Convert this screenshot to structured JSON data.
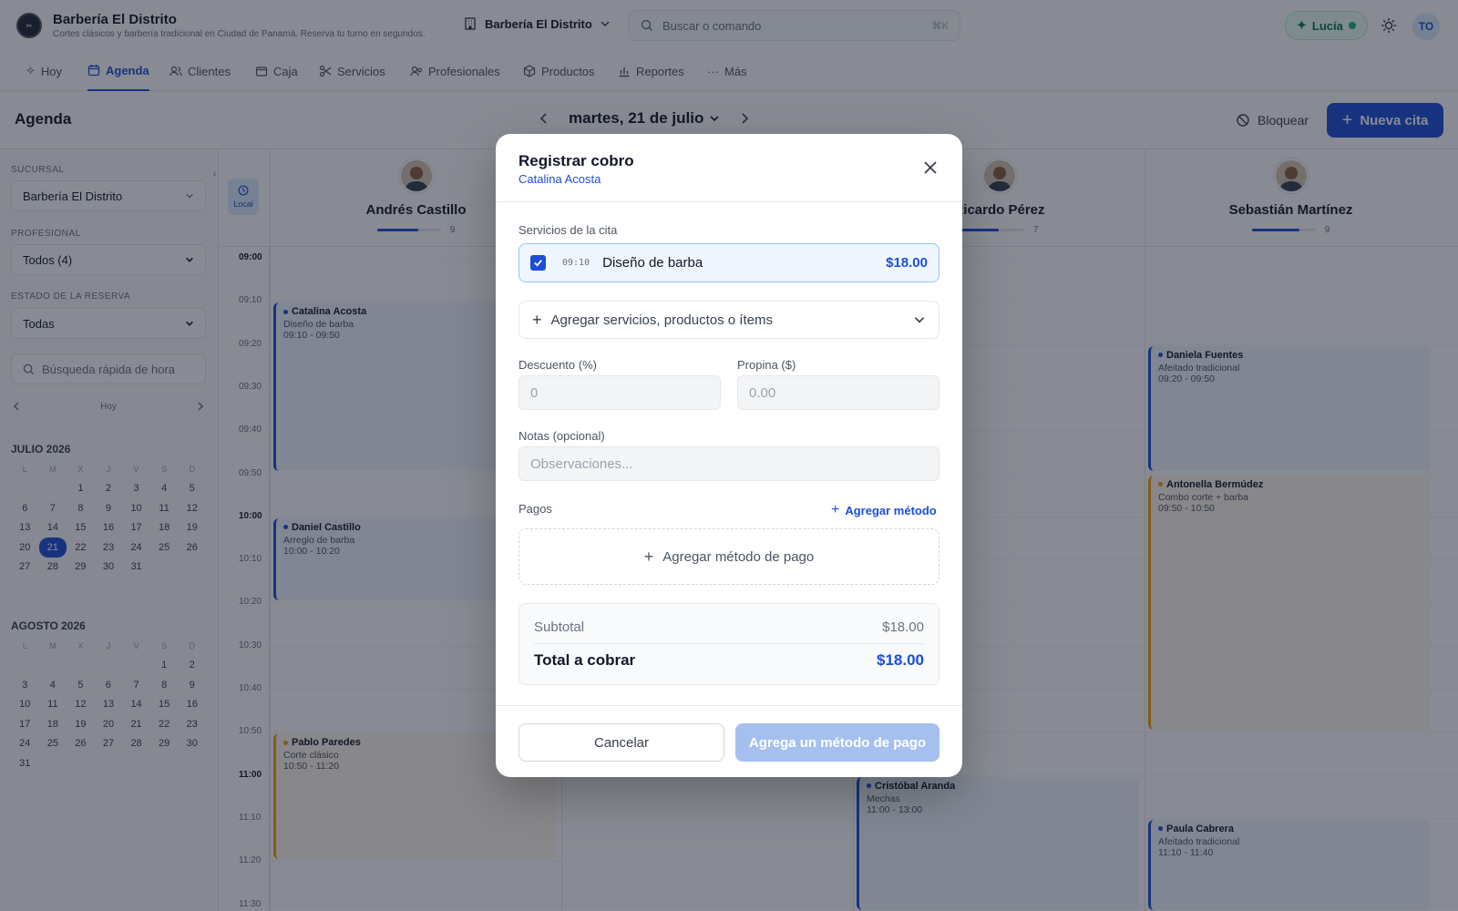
{
  "app": {
    "title": "Barbería El Distrito",
    "subtitle": "Cortes clásicos y barbería tradicional en Ciudad de Panamá. Reserva tu turno en segundos.",
    "branch_selector": "Barbería El Distrito",
    "search_placeholder": "Buscar o comando",
    "search_shortcut": "⌘K",
    "assistant_label": "Lucía",
    "user_initials": "TO"
  },
  "nav": {
    "items": [
      {
        "label": "Hoy",
        "icon": "sparkle-icon"
      },
      {
        "label": "Agenda",
        "icon": "calendar-icon",
        "active": true
      },
      {
        "label": "Clientes",
        "icon": "users-icon"
      },
      {
        "label": "Caja",
        "icon": "wallet-icon"
      },
      {
        "label": "Servicios",
        "icon": "scissors-icon"
      },
      {
        "label": "Profesionales",
        "icon": "user-group-icon"
      },
      {
        "label": "Productos",
        "icon": "box-icon"
      },
      {
        "label": "Reportes",
        "icon": "chart-icon"
      },
      {
        "label": "Más",
        "icon": "more-icon"
      }
    ]
  },
  "page": {
    "title": "Agenda",
    "date": "martes, 21 de julio",
    "block_label": "Bloquear",
    "new_appointment_label": "Nueva cita"
  },
  "sidebar": {
    "branch_label": "SUCURSAL",
    "branch_value": "Barbería El Distrito",
    "professional_label": "PROFESIONAL",
    "professional_value": "Todos (4)",
    "status_label": "ESTADO DE LA RESERVA",
    "status_value": "Todas",
    "quick_search_placeholder": "Búsqueda rápida de hora",
    "today_label": "Hoy",
    "weekday_headers": [
      "L",
      "M",
      "X",
      "J",
      "V",
      "S",
      "D"
    ],
    "months": [
      {
        "title": "JULIO 2026",
        "offset": 2,
        "days": 31,
        "selected": 21
      },
      {
        "title": "AGOSTO 2026",
        "offset": 5,
        "days": 31,
        "selected": null
      }
    ]
  },
  "calendar": {
    "timezone_label": "Local",
    "staff": [
      {
        "name": "Andrés Castillo",
        "count": "9",
        "load": 0.65
      },
      {
        "name": "",
        "count": "",
        "load": 0
      },
      {
        "name": "Ricardo Pérez",
        "count": "7",
        "load": 0.6
      },
      {
        "name": "Sebastián Martínez",
        "count": "9",
        "load": 0.75
      }
    ],
    "times": [
      "09:00",
      "09:10",
      "09:20",
      "09:30",
      "09:40",
      "09:50",
      "10:00",
      "10:10",
      "10:20",
      "10:30",
      "10:40",
      "10:50",
      "11:00",
      "11:10",
      "11:20",
      "11:30"
    ],
    "appointments": [
      {
        "col": 0,
        "client": "Catalina Acosta",
        "service": "Diseño de barba",
        "time": "09:10 - 09:50",
        "color": "blue"
      },
      {
        "col": 0,
        "client": "Daniel Castillo",
        "service": "Arreglo de barba",
        "time": "10:00 - 10:20",
        "color": "blue"
      },
      {
        "col": 0,
        "client": "Pablo Paredes",
        "service": "Corte clásico",
        "time": "10:50 - 11:20",
        "color": "orange"
      },
      {
        "col": 2,
        "client": "Cristóbal Aranda",
        "service": "Mechas",
        "time": "11:00 - 13:00",
        "color": "blue"
      },
      {
        "col": 3,
        "client": "Daniela Fuentes",
        "service": "Afeitado tradicional",
        "time": "09:20 - 09:50",
        "color": "blue"
      },
      {
        "col": 3,
        "client": "Antonella Bermúdez",
        "service": "Combo corte + barba",
        "time": "09:50 - 10:50",
        "color": "orange"
      },
      {
        "col": 3,
        "client": "Paula Cabrera",
        "service": "Afeitado tradicional",
        "time": "11:10 - 11:40",
        "color": "blue"
      }
    ]
  },
  "modal": {
    "title": "Registrar cobro",
    "client": "Catalina Acosta",
    "services_label": "Servicios de la cita",
    "service": {
      "time": "09:10",
      "name": "Diseño de barba",
      "price": "$18.00",
      "checked": true
    },
    "add_items_label": "Agregar servicios, productos o ítems",
    "discount_label": "Descuento (%)",
    "discount_placeholder": "0",
    "tip_label": "Propina ($)",
    "tip_placeholder": "0.00",
    "notes_label": "Notas (opcional)",
    "notes_placeholder": "Observaciones...",
    "payments_label": "Pagos",
    "add_method_link": "Agregar método",
    "add_payment_method": "Agregar método de pago",
    "subtotal_label": "Subtotal",
    "subtotal_value": "$18.00",
    "total_label": "Total a cobrar",
    "total_value": "$18.00",
    "cancel_label": "Cancelar",
    "submit_label": "Agrega un método de pago"
  },
  "colors": {
    "accent": "#1d4ed8",
    "success": "#10b981",
    "warning": "#f59e0b"
  }
}
